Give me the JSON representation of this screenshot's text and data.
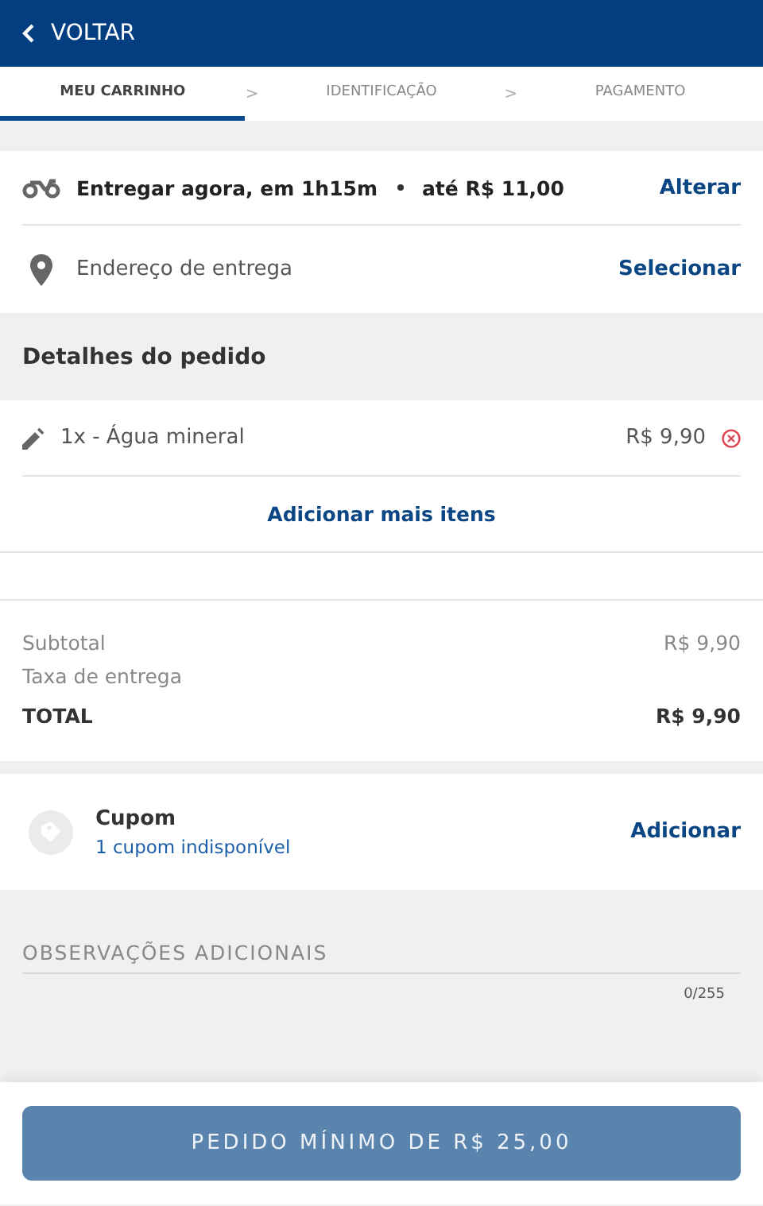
{
  "header": {
    "back_label": "VOLTAR"
  },
  "steps": [
    {
      "label": "MEU CARRINHO",
      "selected": true,
      "separator_after": ">"
    },
    {
      "label": "IDENTIFICAÇÃO",
      "selected": false,
      "separator_after": ">"
    },
    {
      "label": "PAGAMENTO",
      "selected": false
    }
  ],
  "delivery": {
    "time": "Entregar agora, em 1h15m",
    "fee": "até R$ 11,00",
    "change_link": "Alterar",
    "address_label": "Endereço de entrega",
    "address_link": "Selecionar"
  },
  "order": {
    "title": "Detalhes do pedido",
    "items": [
      {
        "name": "1x - Água mineral",
        "price": "R$ 9,90"
      }
    ],
    "add_more": "Adicionar mais itens"
  },
  "totals": [
    {
      "label": "Subtotal",
      "value": "R$ 9,90",
      "kind": "normal"
    },
    {
      "label": "Taxa de entrega",
      "kind": "normal"
    },
    {
      "label": "TOTAL",
      "value": "R$ 9,90",
      "kind": "total"
    }
  ],
  "coupon": {
    "title": "Cupom",
    "status": "1 cupom indisponível",
    "action": "Adicionar"
  },
  "notes": {
    "placeholder": "OBSERVAÇÕES ADICIONAIS",
    "counter": "0/255"
  },
  "submit": {
    "label": "PEDIDO MÍNIMO DE R$ 25,00",
    "disabled": true
  }
}
